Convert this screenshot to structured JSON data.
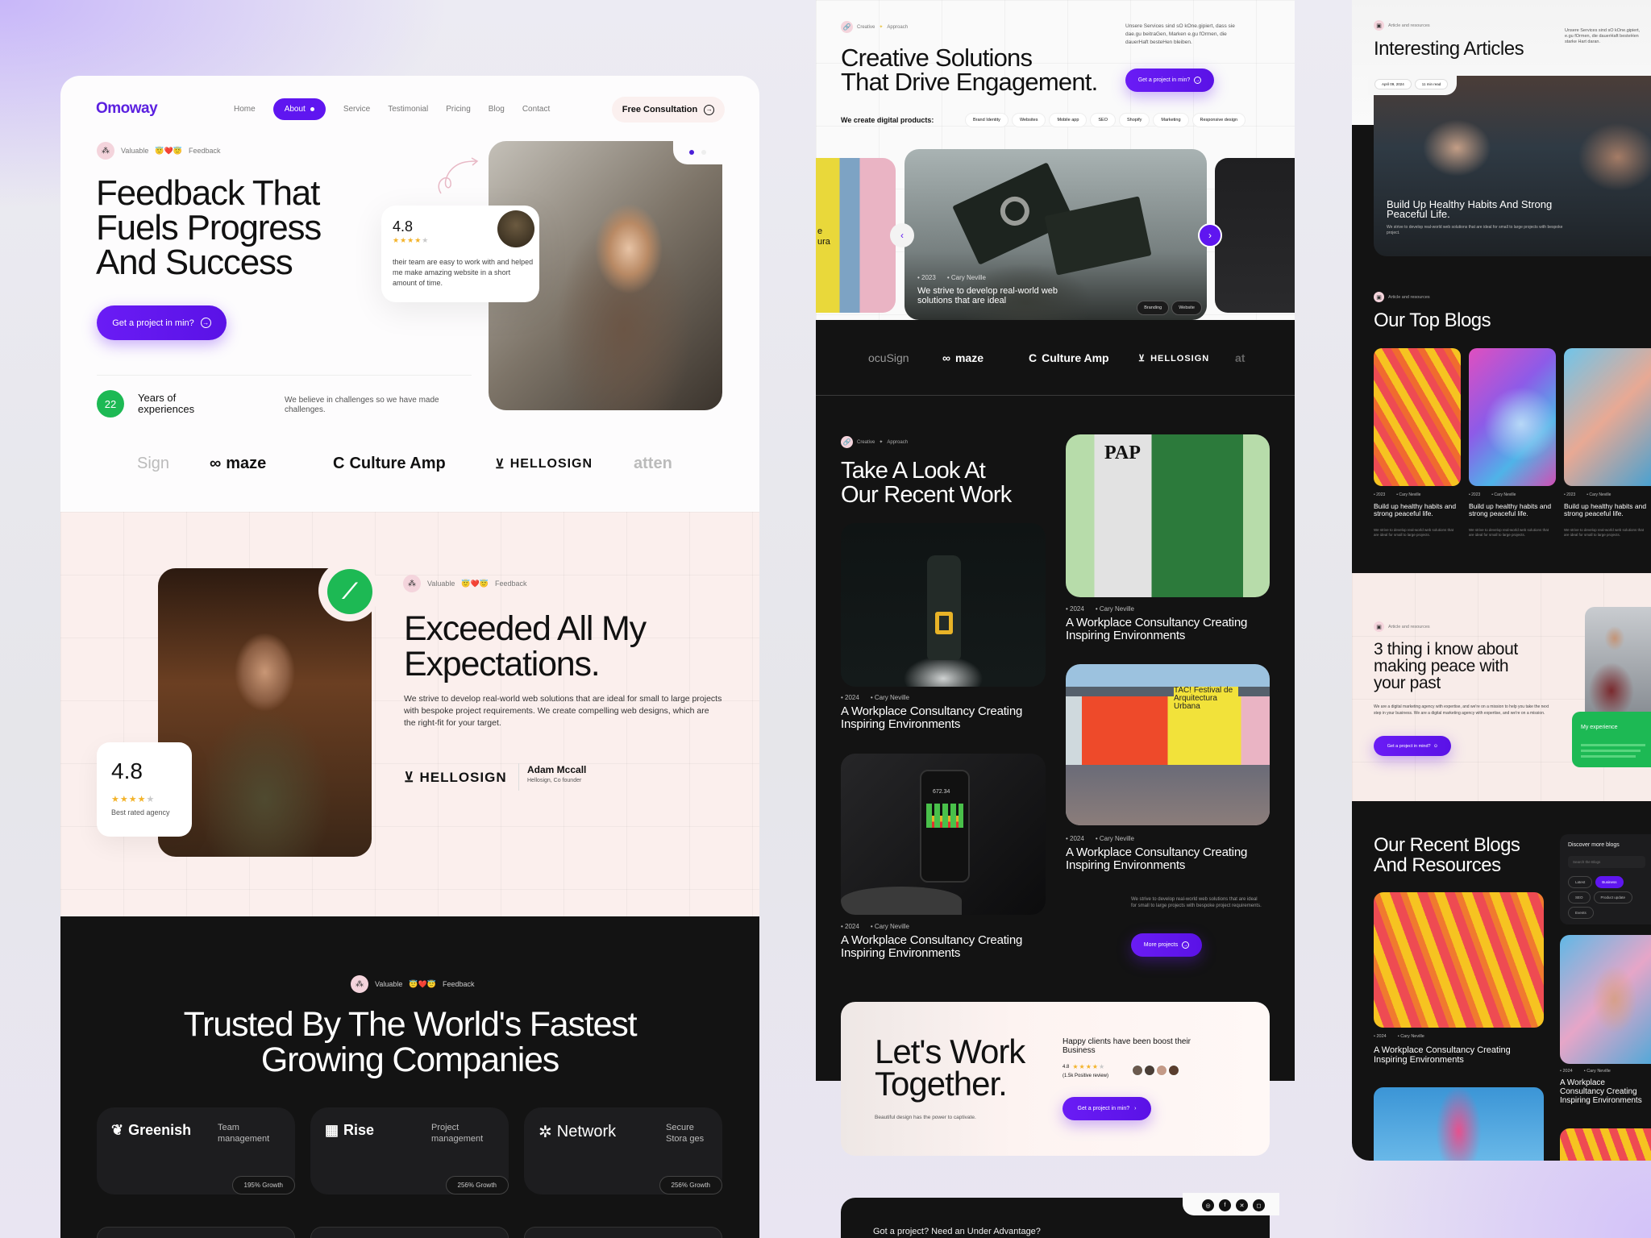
{
  "colors": {
    "accent": "#5f16f0",
    "green": "#1db954",
    "dark": "#121214",
    "pink": "#fbeeed"
  },
  "left": {
    "brand": "Omoway",
    "nav": [
      "Home",
      "About",
      "Service",
      "Testimonial",
      "Pricing",
      "Blog",
      "Contact"
    ],
    "nav_active": "About",
    "cta_header": "Free Consultation",
    "badge": {
      "pre": "Valuable",
      "emoji": "😇❤️😇",
      "post": "Feedback"
    },
    "hero_title": [
      "Feedback That",
      "Fuels Progress",
      "And Success"
    ],
    "hero_button": "Get a project in min?",
    "review": {
      "rating": "4.8",
      "stars": 4,
      "text": "their team are easy to work with and helped me make amazing website in a short amount of time."
    },
    "years": {
      "value": "22",
      "label": [
        "Years of",
        "experiences"
      ]
    },
    "years_note": "We believe in challenges so we have made challenges.",
    "logos": [
      "Sign",
      "maze",
      "Culture Amp",
      "HELLOSIGN",
      "atten"
    ],
    "testimonial": {
      "title": [
        "Exceeded All My",
        "Expectations."
      ],
      "body": "We strive to develop real-world web solutions that are ideal for  small to large projects with bespoke project requirements. We create compelling web designs, which are the right-fit for your target.",
      "company": "HELLOSIGN",
      "person": "Adam Mccall",
      "role": "Hellosign, Co founder",
      "rating": "4.8",
      "stars": 4,
      "rating_label": "Best rated agency"
    },
    "trusted": {
      "title": [
        "Trusted By The World's Fastest",
        "Growing Companies"
      ],
      "cards": [
        {
          "logo": "Greenish",
          "desc": "Team management",
          "growth": "195% Growth"
        },
        {
          "logo": "Rise",
          "desc": "Project management",
          "growth": "256% Growth"
        },
        {
          "logo": "Network",
          "desc": "Secure Stora ges",
          "growth": "256% Growth"
        }
      ]
    }
  },
  "middle": {
    "badge": {
      "pre": "Creative",
      "post": "Approach"
    },
    "title": [
      "Creative Solutions",
      "That Drive Engagement."
    ],
    "intro": "Unsere Services sind sO kOne.gipiert, dass sie dae.gu beitraGen, Marken e.gu fOrmen, die dauerHaft besteHen bleiben.",
    "button": "Get a project in min?",
    "products_label": "We create digital products:",
    "products": [
      "Brand Identity",
      "Websites",
      "Mobile app",
      "SEO",
      "Shopify",
      "Marketing",
      "Responsive design"
    ],
    "carousel": {
      "year": "2023",
      "author": "Cary Neville",
      "caption": "We strive to develop real-world web solutions that are ideal",
      "tags": [
        "Branding",
        "Website"
      ],
      "side_text": "e ura"
    },
    "logos": [
      "ocuSign",
      "maze",
      "Culture Amp",
      "HELLOSIGN",
      "at"
    ],
    "work": {
      "badge": {
        "pre": "Creative",
        "post": "Approach"
      },
      "title": [
        "Take A Look At",
        "Our Recent Work"
      ],
      "items": [
        {
          "year": "2024",
          "author": "Cary Neville",
          "title": "A Workplace Consultancy Creating Inspiring Environments"
        },
        {
          "year": "2024",
          "author": "Cary Neville",
          "title": "A Workplace Consultancy Creating Inspiring Environments"
        },
        {
          "year": "2024",
          "author": "Cary Neville",
          "title": "A Workplace Consultancy Creating Inspiring Environments"
        },
        {
          "year": "2024",
          "author": "Cary Neville",
          "title": "A Workplace Consultancy Creating Inspiring Environments"
        }
      ],
      "pap": "PAP",
      "tac": "TAC! Festival de Arquitectura Urbana",
      "phone_value": "672.34",
      "note": "We strive to develop real-world web solutions that are ideal for small to large projects with bespoke project requirements.",
      "more": "More projects"
    },
    "cta": {
      "title": [
        "Let's Work",
        "Together."
      ],
      "sub": "Beautiful design has the power to captivate.",
      "headline": "Happy clients have been boost their Business",
      "rating": "4.8",
      "stars": 4,
      "reviews": "(1.5k Positive review)",
      "button": "Get a project in min?"
    },
    "footer_q": "Got a project? Need an Under Advantage?",
    "socials": [
      "dribbble-icon",
      "facebook-icon",
      "x-icon",
      "instagram-icon"
    ]
  },
  "right": {
    "badge": "Article and resources",
    "title": "Interesting Articles",
    "intro": "Unsere Services sind sO kOne.gipiert, e.gu fOrmen, die dauerHaft besteHen starke Hart daran.",
    "date": "April 09, 2024",
    "read": "11 min read",
    "feature": {
      "title": "Build Up Healthy Habits And Strong Peaceful Life.",
      "desc": "We strive to develop real-world web solutions that are ideal for small to large projects with bespoke project."
    },
    "top_badge": "Article and resources",
    "top_title": "Our Top Blogs",
    "blogs": [
      {
        "year": "2023",
        "author": "Cary Neville",
        "title": "Build up healthy habits and strong peaceful life.",
        "desc": "We strive to develop real-world web solutions that are ideal for small to large projects."
      },
      {
        "year": "2023",
        "author": "Cary Neville",
        "title": "Build up healthy habits and strong peaceful life.",
        "desc": "We strive to develop real-world web solutions that are ideal for small to large projects."
      },
      {
        "year": "2023",
        "author": "Cary Neville",
        "title": "Build up healthy habits and strong peaceful life.",
        "desc": "We strive to develop real-world web solutions that are ideal for small to large projects."
      }
    ],
    "peace": {
      "badge": "Article and resources",
      "title": "3 thing i know about making peace with your past",
      "body": "We are a digital marketing agency with expertise, and we're on a mission to help you take the next step in your business. We are a digital marketing agency with expertise, and we're on a mission.",
      "button": "Get a project in mind?",
      "experience": "My experience"
    },
    "recent": {
      "title": [
        "Our Recent Blogs",
        "And Resources"
      ],
      "discover": "Discover more blogs",
      "search_placeholder": "Search the Blogs",
      "filters": [
        "Latest",
        "Business",
        "SEO",
        "Product update",
        "Events"
      ],
      "active_filter": "Business",
      "items": [
        {
          "year": "2024",
          "author": "Cary Neville",
          "title": "A Workplace Consultancy Creating Inspiring Environments"
        },
        {
          "year": "2024",
          "author": "Cary Neville",
          "title": "A Workplace Consultancy Creating Inspiring Environments"
        }
      ]
    }
  }
}
